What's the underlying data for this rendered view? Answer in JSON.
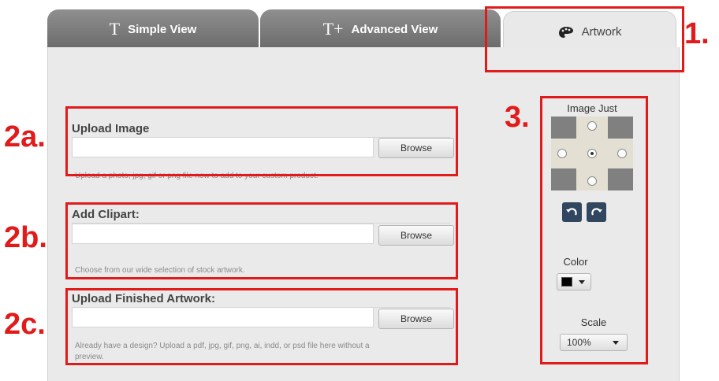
{
  "tabs": [
    {
      "glyph": "T",
      "label": "Simple View"
    },
    {
      "glyph": "T+",
      "label": "Advanced View"
    },
    {
      "icon": "palette-icon",
      "label": "Artwork"
    }
  ],
  "annotations": {
    "tab": "1.",
    "upload": "2a.",
    "clipart": "2b.",
    "finished": "2c.",
    "controls": "3."
  },
  "sections": {
    "upload_image": {
      "title": "Upload Image",
      "button": "Browse",
      "help": "Upload a photo, jpg, gif or png file now to add to your custom product."
    },
    "add_clipart": {
      "title": "Add Clipart:",
      "button": "Browse",
      "help": "Choose from our wide selection of stock artwork."
    },
    "upload_finished": {
      "title": "Upload Finished Artwork:",
      "button": "Browse",
      "help": "Already have a design? Upload a pdf, jpg, gif, png, ai, indd, or psd file here without a preview."
    }
  },
  "controls": {
    "image_just_label": "Image Just",
    "color_label": "Color",
    "color_value": "#000000",
    "scale_label": "Scale",
    "scale_value": "100%"
  },
  "colors": {
    "annotation_red": "#e11b1b",
    "rotate_button": "#31465f"
  }
}
